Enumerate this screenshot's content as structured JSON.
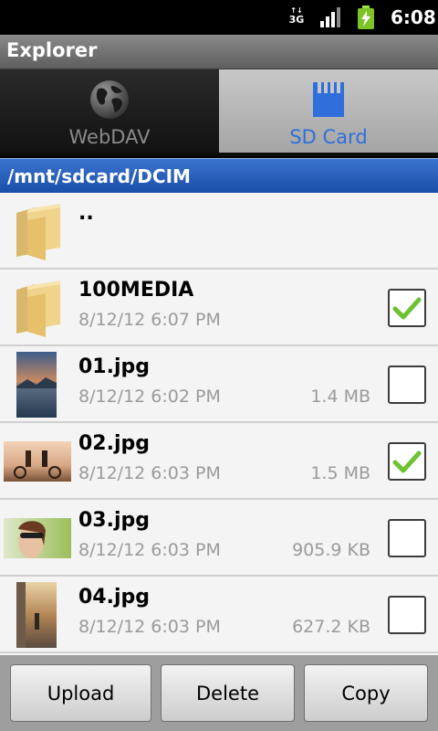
{
  "status_bar": {
    "network": "3G",
    "time": "6:08",
    "icons": [
      "3g-signal-icon",
      "signal-bars-icon",
      "battery-charging-icon"
    ]
  },
  "title_bar": {
    "title": "Explorer"
  },
  "tabs": [
    {
      "label": "WebDAV",
      "icon": "globe-icon",
      "selected": false
    },
    {
      "label": "SD Card",
      "icon": "sd-card-icon",
      "selected": true
    }
  ],
  "path": "/mnt/sdcard/DCIM",
  "files": [
    {
      "name": "..",
      "date": "",
      "size": "",
      "icon": "folder-icon",
      "checkable": false,
      "checked": false
    },
    {
      "name": "100MEDIA",
      "date": "8/12/12 6:07 PM",
      "size": "",
      "icon": "folder-icon",
      "checkable": true,
      "checked": true
    },
    {
      "name": "01.jpg",
      "date": "8/12/12 6:02 PM",
      "size": "1.4 MB",
      "icon": "image-thumbnail",
      "checkable": true,
      "checked": false
    },
    {
      "name": "02.jpg",
      "date": "8/12/12 6:03 PM",
      "size": "1.5 MB",
      "icon": "image-thumbnail",
      "checkable": true,
      "checked": true
    },
    {
      "name": "03.jpg",
      "date": "8/12/12 6:03 PM",
      "size": "905.9 KB",
      "icon": "image-thumbnail",
      "checkable": true,
      "checked": false
    },
    {
      "name": "04.jpg",
      "date": "8/12/12 6:03 PM",
      "size": "627.2 KB",
      "icon": "image-thumbnail",
      "checkable": true,
      "checked": false
    }
  ],
  "actions": {
    "upload": "Upload",
    "delete": "Delete",
    "copy": "Copy"
  },
  "colors": {
    "accent": "#2f6fdb",
    "check": "#6cc231",
    "path_bar": "#2a5fba"
  }
}
